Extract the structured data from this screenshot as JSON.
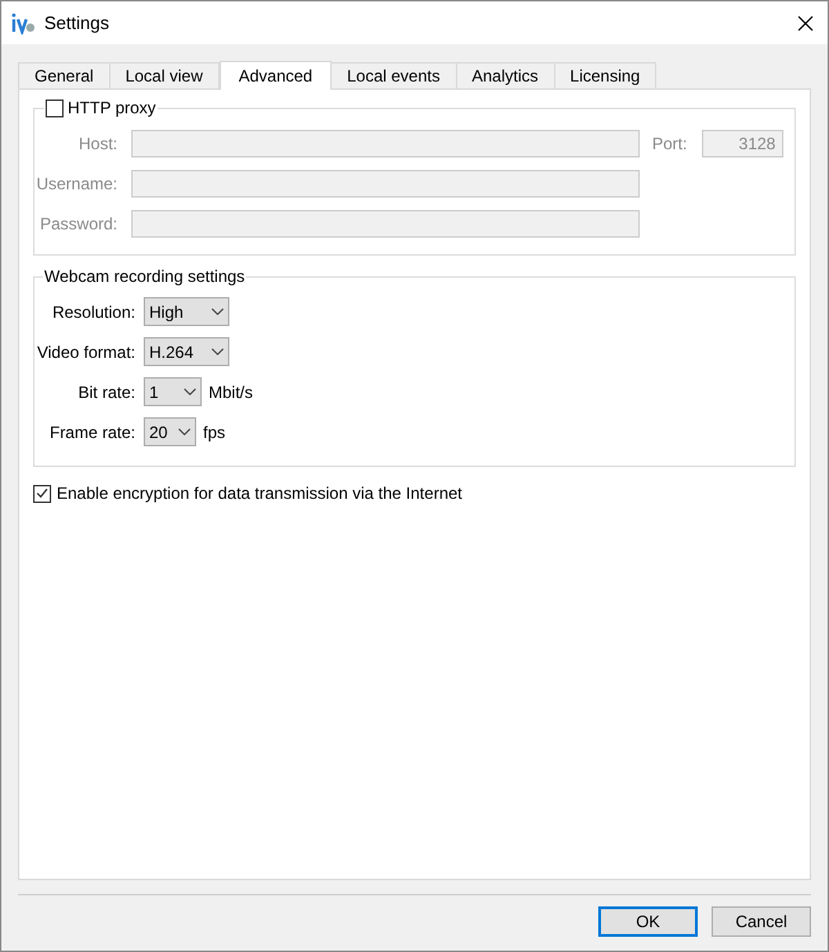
{
  "window": {
    "title": "Settings"
  },
  "tabs": [
    {
      "label": "General",
      "selected": false
    },
    {
      "label": "Local view",
      "selected": false
    },
    {
      "label": "Advanced",
      "selected": true
    },
    {
      "label": "Local events",
      "selected": false
    },
    {
      "label": "Analytics",
      "selected": false
    },
    {
      "label": "Licensing",
      "selected": false
    }
  ],
  "proxy": {
    "label": "HTTP proxy",
    "checked": false,
    "host_label": "Host:",
    "port_label": "Port:",
    "port_value": "3128",
    "username_label": "Username:",
    "password_label": "Password:"
  },
  "webcam": {
    "title": "Webcam recording settings",
    "rows": [
      {
        "label": "Resolution:",
        "value": "High",
        "unit": null
      },
      {
        "label": "Video format:",
        "value": "H.264",
        "unit": null
      },
      {
        "label": "Bit rate:",
        "value": "1",
        "unit": "Mbit/s"
      },
      {
        "label": "Frame rate:",
        "value": "20",
        "unit": "fps"
      }
    ]
  },
  "encryption": {
    "label": "Enable encryption for data transmission via the Internet",
    "checked": true
  },
  "buttons": [
    {
      "label": "OK",
      "default": true
    },
    {
      "label": "Cancel",
      "default": false
    }
  ]
}
